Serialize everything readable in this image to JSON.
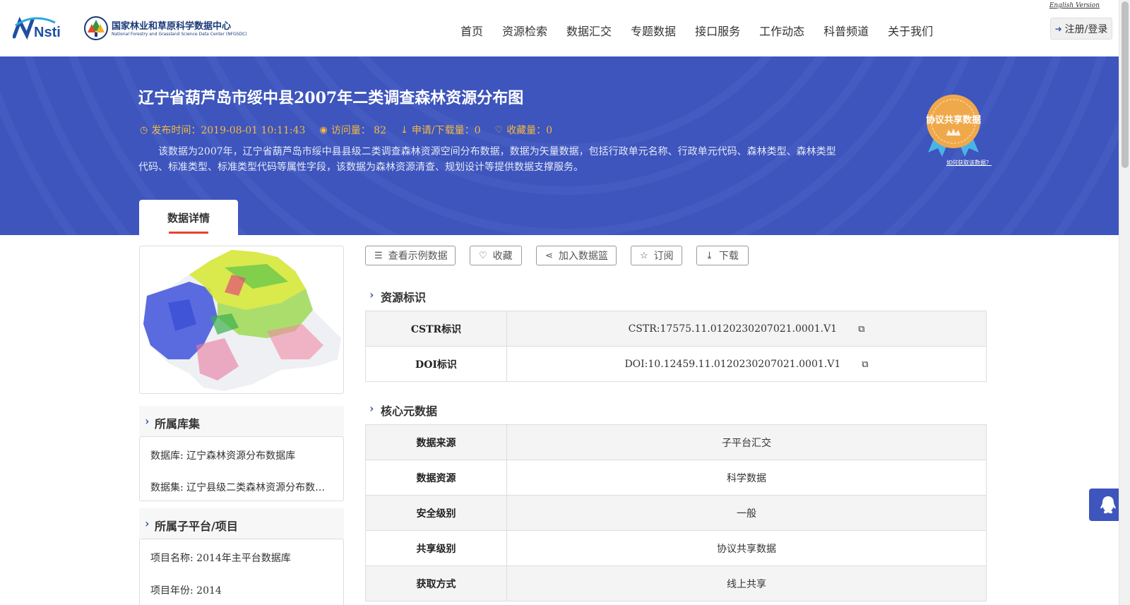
{
  "header": {
    "logo_nsti_text": "Nsti",
    "logo_cn": "国家林业和草原科学数据中心",
    "logo_en": "National Forestry and Grassland Science Data Center (NFGSDC)",
    "english_link": "English Version",
    "nav": [
      "首页",
      "资源检索",
      "数据汇交",
      "专题数据",
      "接口服务",
      "工作动态",
      "科普频道",
      "关于我们"
    ],
    "login_label": "注册/登录"
  },
  "dataset": {
    "title": "辽宁省葫芦岛市绥中县2007年二类调查森林资源分布图",
    "publish_time": "发布时间：2019-08-01 10:11:43",
    "visits": "访问量： 82",
    "downloads": "申请/下载量：0",
    "favorites": "收藏量：0",
    "description": "该数据为2007年，辽宁省葫芦岛市绥中县县级二类调查森林资源空间分布数据，数据为矢量数据，包括行政单元名称、行政单元代码、森林类型、森林类型代码、标准类型、标准类型代码等属性字段，该数据为森林资源清查、规划设计等提供数据支撑服务。",
    "badge_text": "协议共享数据",
    "badge_link": "如何获取该数据？",
    "tab_label": "数据详情"
  },
  "sidebar": {
    "library_title": "所属库集",
    "database": "数据库: 辽宁森林资源分布数据库",
    "dataset_set": "数据集: 辽宁县级二类森林资源分布数…",
    "platform_title": "所属子平台/项目",
    "project_name": "项目名称: 2014年主平台数据库",
    "project_year": "项目年份: 2014"
  },
  "actions": {
    "sample": "查看示例数据",
    "favorite": "收藏",
    "basket": "加入数据篮",
    "subscribe": "订阅",
    "download": "下载"
  },
  "resource_id": {
    "title": "资源标识",
    "rows": [
      {
        "key": "CSTR标识",
        "value": "CSTR:17575.11.0120230207021.0001.V1"
      },
      {
        "key": "DOI标识",
        "value": "DOI:10.12459.11.0120230207021.0001.V1"
      }
    ]
  },
  "core_meta": {
    "title": "核心元数据",
    "rows": [
      {
        "key": "数据来源",
        "value": "子平台汇交"
      },
      {
        "key": "数据资源",
        "value": "科学数据"
      },
      {
        "key": "安全级别",
        "value": "一般"
      },
      {
        "key": "共享级别",
        "value": "协议共享数据"
      },
      {
        "key": "获取方式",
        "value": "线上共享"
      }
    ]
  },
  "colors": {
    "banner": "#3d55bc",
    "meta_text": "#f5b942",
    "tab_underline": "#e8432c",
    "badge": "#f0a94a"
  }
}
